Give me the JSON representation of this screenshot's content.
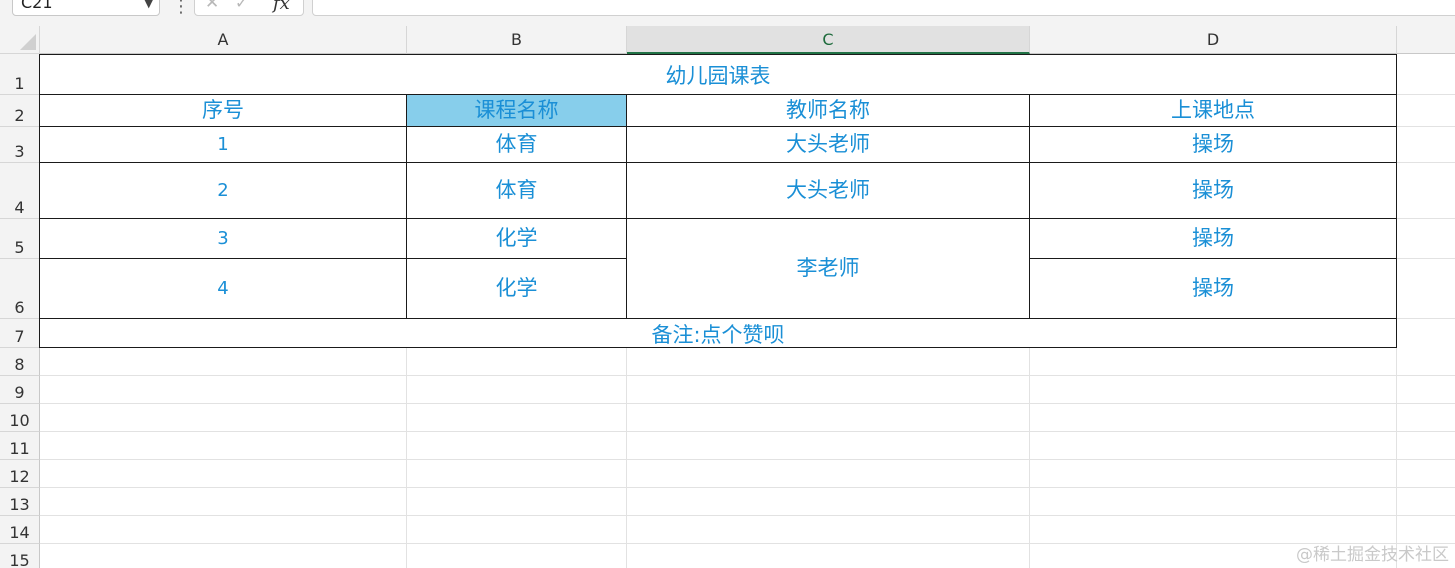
{
  "formula_bar": {
    "name_box": "C21",
    "fx_label": "fx",
    "cancel_glyph": "✕",
    "enter_glyph": "✓",
    "formula_value": ""
  },
  "columns": [
    "A",
    "B",
    "C",
    "D"
  ],
  "selected_column": "C",
  "rows": [
    "1",
    "2",
    "3",
    "4",
    "5",
    "6",
    "7",
    "8",
    "9",
    "10",
    "11",
    "12",
    "13",
    "14",
    "15"
  ],
  "sheet": {
    "title": "幼儿园课表",
    "headers": [
      "序号",
      "课程名称",
      "教师名称",
      "上课地点"
    ],
    "records": [
      {
        "num": "1",
        "course": "体育",
        "teacher": "大头老师",
        "location": "操场"
      },
      {
        "num": "2",
        "course": "体育",
        "teacher": "大头老师",
        "location": "操场"
      },
      {
        "num": "3",
        "course": "化学",
        "teacher": "李老师",
        "location": "操场"
      },
      {
        "num": "4",
        "course": "化学",
        "teacher": "",
        "location": "操场"
      }
    ],
    "note": "备注:点个赞呗"
  },
  "colors": {
    "text_blue": "#1a8fd6",
    "header_fill": "#87ceeb",
    "selected_accent": "#217346"
  },
  "watermark": "@稀土掘金技术社区"
}
